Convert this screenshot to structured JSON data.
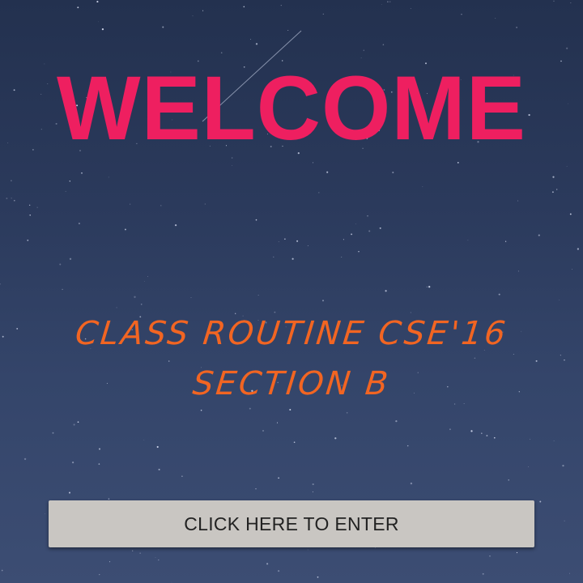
{
  "header": {
    "title": "WELCOME"
  },
  "main": {
    "subtitle_line1": "CLASS ROUTINE CSE'16",
    "subtitle_line2": "SECTION B",
    "enter_button_label": "CLICK HERE TO ENTER"
  },
  "colors": {
    "title": "#ee1f60",
    "subtitle": "#f26522",
    "button_bg": "#c9c6c2",
    "background": "#2b3a5c"
  }
}
